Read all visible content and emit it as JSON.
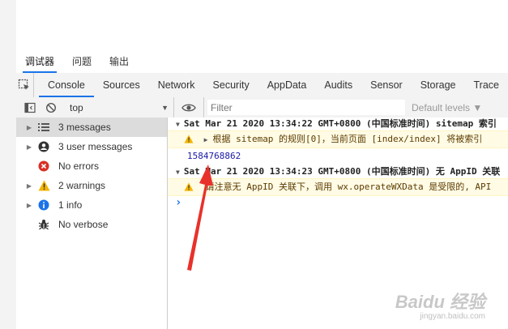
{
  "panel_tabs": [
    {
      "label": "调试器",
      "active": true
    },
    {
      "label": "问题",
      "active": false
    },
    {
      "label": "输出",
      "active": false
    }
  ],
  "tool_tabs": [
    {
      "label": "Console",
      "active": true
    },
    {
      "label": "Sources"
    },
    {
      "label": "Network"
    },
    {
      "label": "Security"
    },
    {
      "label": "AppData"
    },
    {
      "label": "Audits"
    },
    {
      "label": "Sensor"
    },
    {
      "label": "Storage"
    },
    {
      "label": "Trace"
    }
  ],
  "filter_bar": {
    "context": "top",
    "filter_placeholder": "Filter",
    "levels": "Default levels ▼"
  },
  "sidebar": {
    "items": [
      {
        "label": "3 messages",
        "icon": "list-icon",
        "caret": true,
        "selected": true
      },
      {
        "label": "3 user messages",
        "icon": "user-icon",
        "caret": true
      },
      {
        "label": "No errors",
        "icon": "error-icon",
        "caret": false
      },
      {
        "label": "2 warnings",
        "icon": "warning-icon",
        "caret": true
      },
      {
        "label": "1 info",
        "icon": "info-icon",
        "caret": true
      },
      {
        "label": "No verbose",
        "icon": "bug-icon",
        "caret": false
      }
    ]
  },
  "console": {
    "group1_header": "Sat Mar 21 2020 13:34:22 GMT+0800 (中国标准时间) sitemap 索引",
    "warn1_text": "根据 sitemap 的规则[0]，当前页面 [index/index] 将被索引",
    "log_value": "1584768862",
    "group2_header": "Sat Mar 21 2020 13:34:23 GMT+0800 (中国标准时间) 无 AppID 关联",
    "warn2_text": "请注意无 AppID 关联下，调用 wx.operateWXData 是受限的, API",
    "prompt": "›"
  },
  "watermark": {
    "logo": "Baidu 经验",
    "url": "jingyan.baidu.com"
  },
  "colors": {
    "accent": "#1a73e8",
    "warning_bg": "#fffbe5",
    "warning_icon": "#f4b400",
    "error_icon": "#d93025",
    "info_icon": "#1a73e8",
    "annotation_arrow": "#e8312a"
  }
}
